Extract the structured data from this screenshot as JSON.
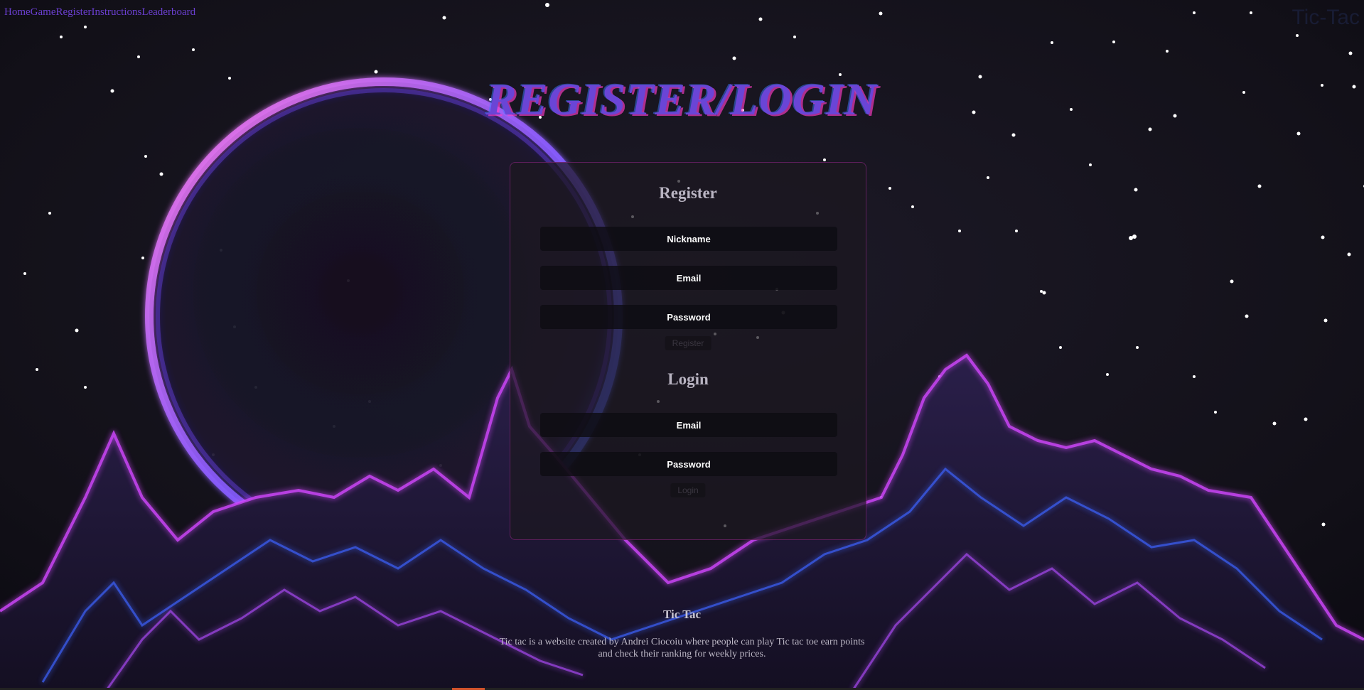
{
  "nav": {
    "items": [
      {
        "label": "Home"
      },
      {
        "label": "Game"
      },
      {
        "label": "Register"
      },
      {
        "label": "Instructions"
      },
      {
        "label": "Leaderboard"
      }
    ]
  },
  "brand": "Tic-Tac",
  "page_title": "REGISTER/LOGIN",
  "register": {
    "title": "Register",
    "nickname_placeholder": "Nickname",
    "email_placeholder": "Email",
    "password_placeholder": "Password",
    "button_label": "Register"
  },
  "login": {
    "title": "Login",
    "email_placeholder": "Email",
    "password_placeholder": "Password",
    "button_label": "Login"
  },
  "footer": {
    "title": "Tic Tac",
    "text": "Tic tac is a website created by Andrei Ciocoiu where people can play Tic tac toe earn points and check their ranking for weekly prices."
  },
  "colors": {
    "nav_link": "#6b3fd1",
    "title": "#6a45d6",
    "panel_border": "#962c8c"
  }
}
